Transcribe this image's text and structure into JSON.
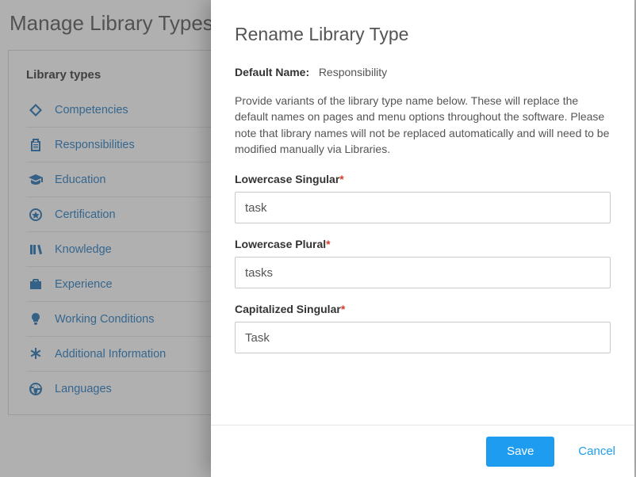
{
  "page": {
    "title": "Manage Library Types",
    "panelHeading": "Library types"
  },
  "libraryTypes": [
    {
      "label": "Competencies",
      "icon": "diamond"
    },
    {
      "label": "Responsibilities",
      "icon": "clipboard"
    },
    {
      "label": "Education",
      "icon": "gradcap"
    },
    {
      "label": "Certification",
      "icon": "badge"
    },
    {
      "label": "Knowledge",
      "icon": "books"
    },
    {
      "label": "Experience",
      "icon": "briefcase"
    },
    {
      "label": "Working Conditions",
      "icon": "lamp"
    },
    {
      "label": "Additional Information",
      "icon": "asterisk"
    },
    {
      "label": "Languages",
      "icon": "globe"
    }
  ],
  "modal": {
    "title": "Rename Library Type",
    "defaultNameLabel": "Default Name:",
    "defaultNameValue": "Responsibility",
    "description": "Provide variants of the library type name below. These will replace the default names on pages and menu options throughout the software. Please note that library names will not be replaced automatically and will need to be modified manually via Libraries.",
    "fields": {
      "lowerSingular": {
        "label": "Lowercase Singular",
        "value": "task"
      },
      "lowerPlural": {
        "label": "Lowercase Plural",
        "value": "tasks"
      },
      "capSingular": {
        "label": "Capitalized Singular",
        "value": "Task"
      }
    },
    "buttons": {
      "save": "Save",
      "cancel": "Cancel"
    }
  }
}
